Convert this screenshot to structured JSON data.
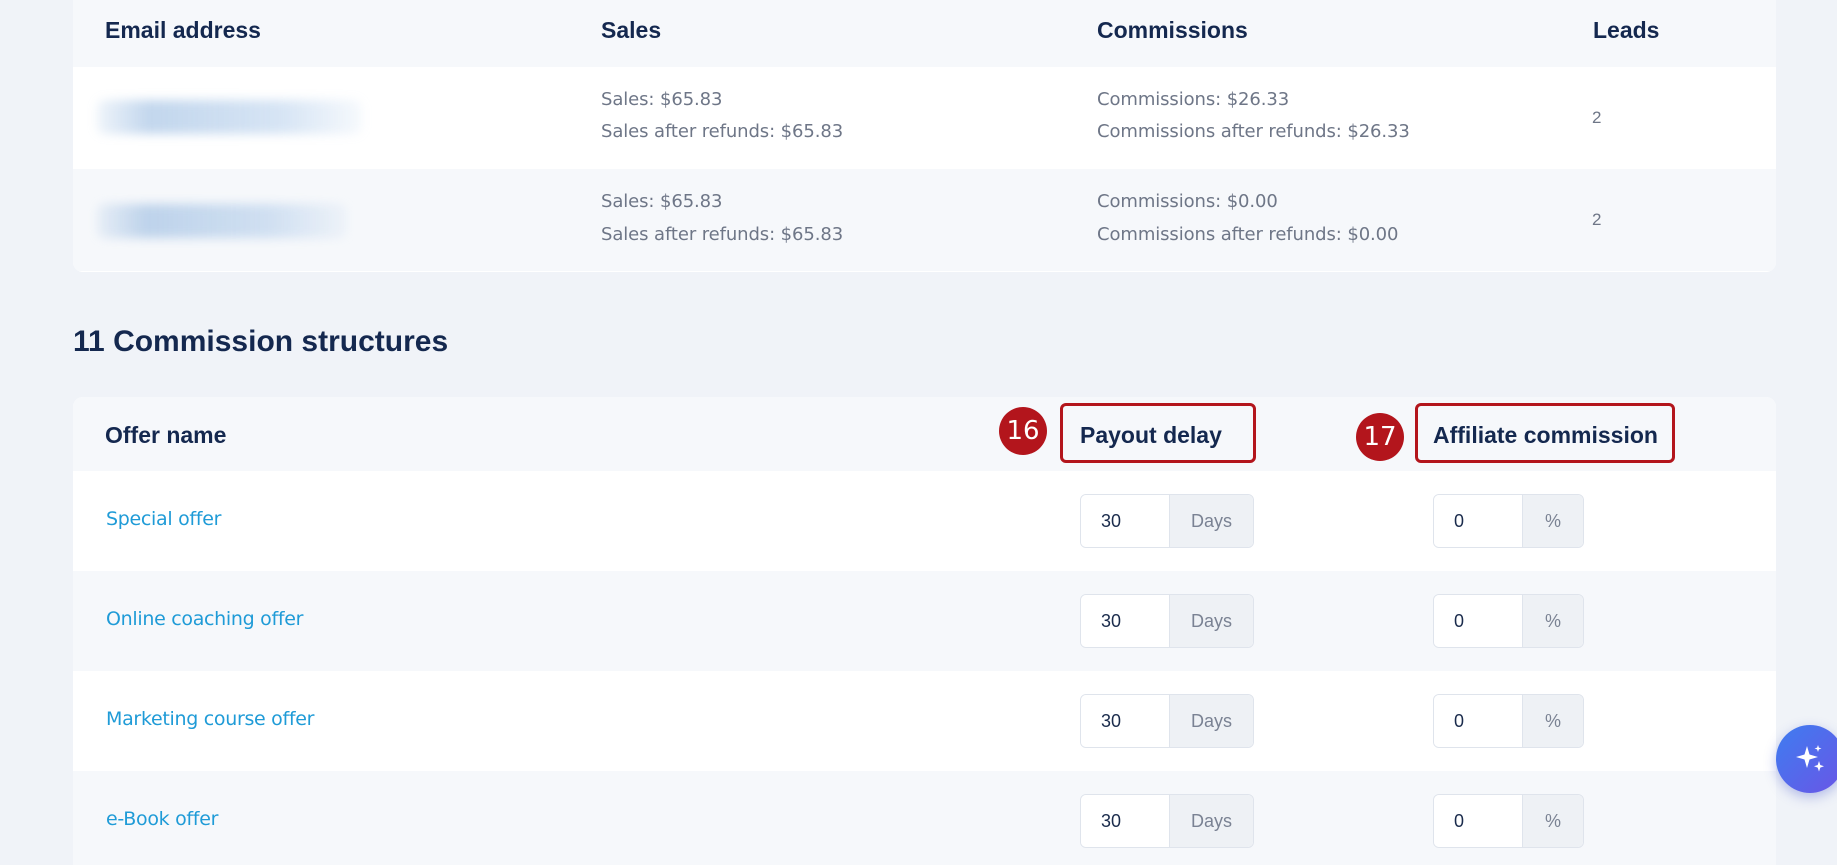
{
  "sales_table": {
    "headers": {
      "email": "Email address",
      "sales": "Sales",
      "commissions": "Commissions",
      "leads": "Leads"
    },
    "rows": [
      {
        "sales": "Sales: $65.83",
        "sales_after_refunds": "Sales after refunds: $65.83",
        "commissions": "Commissions: $26.33",
        "commissions_after_refunds": "Commissions after refunds: $26.33",
        "leads": "2"
      },
      {
        "sales": "Sales: $65.83",
        "sales_after_refunds": "Sales after refunds: $65.83",
        "commissions": "Commissions: $0.00",
        "commissions_after_refunds": "Commissions after refunds: $0.00",
        "leads": "2"
      }
    ]
  },
  "commission_structures": {
    "count": "11",
    "title": "Commission structures",
    "headers": {
      "offer_name": "Offer name",
      "payout_delay": "Payout delay",
      "affiliate_commission": "Affiliate commission"
    },
    "days_unit": "Days",
    "percent_unit": "%",
    "rows": [
      {
        "offer": "Special offer",
        "payout_delay": "30",
        "commission": "0"
      },
      {
        "offer": "Online coaching offer",
        "payout_delay": "30",
        "commission": "0"
      },
      {
        "offer": "Marketing course offer",
        "payout_delay": "30",
        "commission": "0"
      },
      {
        "offer": "e-Book offer",
        "payout_delay": "30",
        "commission": "0"
      }
    ]
  },
  "annotations": {
    "payout_badge": "16",
    "commission_badge": "17",
    "color": "#b3151c"
  },
  "fab": {
    "icon": "sparkles-icon"
  },
  "colors": {
    "background": "#f0f3f8",
    "link": "#1f9bd7",
    "heading": "#14284f",
    "fab_gradient_start": "#3e7df0",
    "fab_gradient_end": "#6a55e6"
  }
}
